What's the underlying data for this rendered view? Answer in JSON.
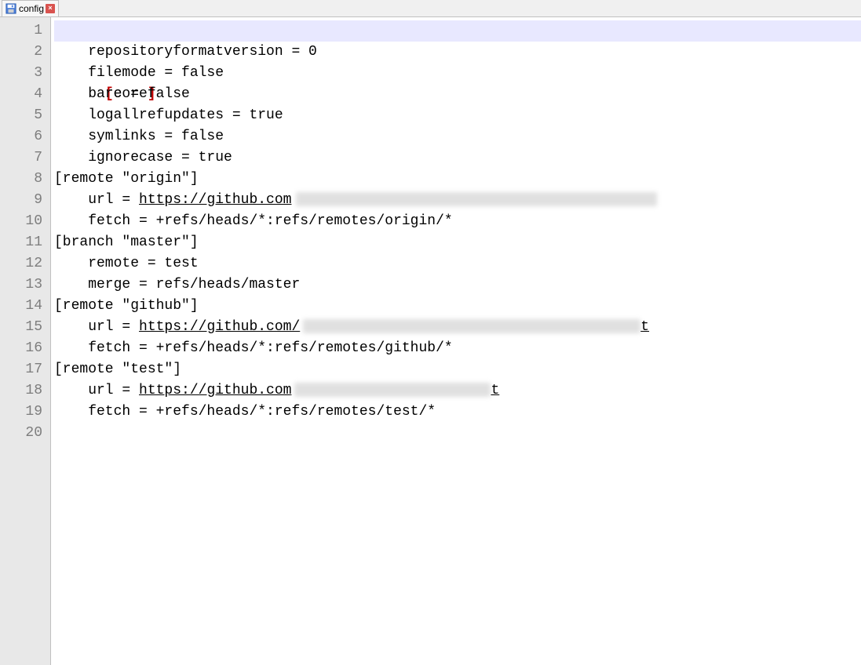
{
  "tab": {
    "filename": "config",
    "close_label": "×"
  },
  "gutter": [
    "1",
    "2",
    "3",
    "4",
    "5",
    "6",
    "7",
    "8",
    "9",
    "10",
    "11",
    "12",
    "13",
    "14",
    "15",
    "16",
    "17",
    "18",
    "19",
    "20"
  ],
  "lines": {
    "l1_open": "[",
    "l1_name": "core",
    "l1_close": "]",
    "l2": "    repositoryformatversion = 0",
    "l3": "    filemode = false",
    "l4": "    bare = false",
    "l5": "    logallrefupdates = true",
    "l6": "    symlinks = false",
    "l7": "    ignorecase = true",
    "l8": "[remote \"origin\"]",
    "l9_pre": "    url = ",
    "l9_url": "https://github.com",
    "l10": "    fetch = +refs/heads/*:refs/remotes/origin/*",
    "l11": "[branch \"master\"]",
    "l12": "    remote = test",
    "l13": "    merge = refs/heads/master",
    "l14": "[remote \"github\"]",
    "l15_pre": "    url = ",
    "l15_url": "https://github.com/",
    "l15_t": "t",
    "l16": "    fetch = +refs/heads/*:refs/remotes/github/*",
    "l17": "[remote \"test\"]",
    "l18_pre": "    url = ",
    "l18_url": "https://github.com",
    "l18_t": "t",
    "l19": "    fetch = +refs/heads/*:refs/remotes/test/*",
    "l20": ""
  }
}
